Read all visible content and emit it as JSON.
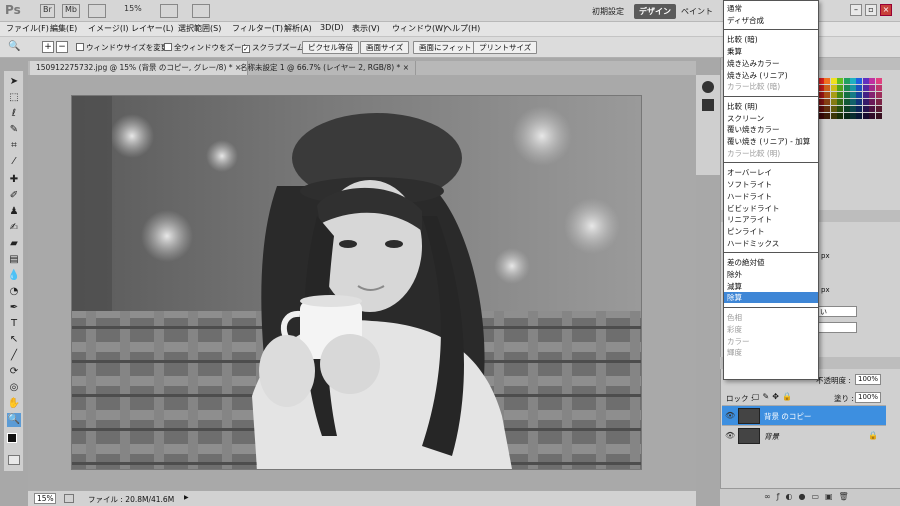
{
  "appbar": {
    "logo": "Ps",
    "icons": [
      "Br",
      "Mb"
    ],
    "zoom": "15%",
    "workspaces": [
      "初期設定",
      "デザイン",
      "ペイント"
    ],
    "active_workspace": "デザイン"
  },
  "menu": [
    "ファイル(F)",
    "編集(E)",
    "イメージ(I)",
    "レイヤー(L)",
    "選択範囲(S)",
    "フィルター(T)",
    "解析(A)",
    "3D(D)",
    "表示(V)",
    "ウィンドウ(W)",
    "ヘルプ(H)"
  ],
  "options": {
    "check1": "ウィンドウサイズを変更",
    "check2": "全ウィンドウをズーム",
    "check3": "スクラブズーム",
    "btn1": "ピクセル等倍",
    "btn2": "画面サイズ",
    "btn3": "画面にフィット",
    "btn4": "プリントサイズ"
  },
  "tabs": [
    "150912275732.jpg @ 15% (背景 のコピー, グレー/8) *",
    "名称未設定 1 @ 66.7% (レイヤー 2, RGB/8) *"
  ],
  "status": {
    "zoom": "15%",
    "file": "ファイル : 20.8M/41.6M"
  },
  "layers": {
    "opacity_label": "不透明度 :",
    "opacity": "100%",
    "lock_label": "ロック :",
    "fill_label": "塗り :",
    "fill": "100%",
    "rows": [
      {
        "name": "背景 のコピー",
        "selected": true
      },
      {
        "name": "背景",
        "selected": false
      }
    ]
  },
  "blend_modes": {
    "groups": [
      [
        "通常",
        "ディザ合成"
      ],
      [
        "比較 (暗)",
        "乗算",
        "焼き込みカラー",
        "焼き込み (リニア)",
        "カラー比較 (暗)"
      ],
      [
        "比較 (明)",
        "スクリーン",
        "覆い焼きカラー",
        "覆い焼き (リニア) - 加算",
        "カラー比較 (明)"
      ],
      [
        "オーバーレイ",
        "ソフトライト",
        "ハードライト",
        "ビビッドライト",
        "リニアライト",
        "ピンライト",
        "ハードミックス"
      ],
      [
        "差の絶対値",
        "除外",
        "減算",
        "除算"
      ],
      [
        "色相",
        "彩度",
        "カラー",
        "輝度"
      ]
    ],
    "selected": "除算"
  },
  "partial_values": {
    "px1": "px",
    "px2": "px",
    "sel": "い"
  }
}
